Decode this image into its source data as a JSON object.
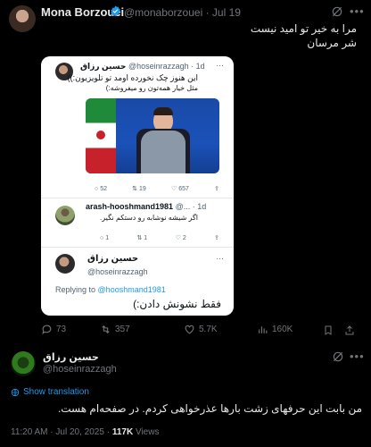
{
  "main_post": {
    "display_name": "Mona Borzouei",
    "handle": "@monaborzouei",
    "dot": "·",
    "date": "Jul 19",
    "text_line1": "مرا به خیر تو امید نیست",
    "text_line2": "شر مرسان"
  },
  "screenshot": {
    "tweet1": {
      "name": "حسین رزاق",
      "handle": "@hoseinrazzagh",
      "time": "· 1d",
      "line1": "این هنوز چک نخورده اومد تو تلویزیون:))",
      "line2": "مثل خیار همه‌تون رو میفروشه:)",
      "stats": {
        "replies": "52",
        "reposts": "19",
        "likes": "657"
      }
    },
    "tweet2": {
      "name": "arash-hooshmand1981",
      "handle": "@...",
      "time": "· 1d",
      "text": "اگر شیشه نوشابه رو دستکم نگیر.",
      "stats": {
        "replies": "1",
        "reposts": "1",
        "likes": "2"
      }
    },
    "tweet3": {
      "name": "حسین رزاق",
      "handle": "@hoseinrazzagh",
      "replying_prefix": "Replying to",
      "replying_to": "@hooshmand1981",
      "text": "فقط نشونش دادن:)"
    }
  },
  "main_actions": {
    "replies": "73",
    "reposts": "357",
    "likes": "5.7K",
    "views": "160K"
  },
  "reply": {
    "display_name": "حسین رزاق",
    "handle": "@hoseinrazzagh",
    "show_translation": "Show translation",
    "text": "من بابت این حرفهای زشت بارها عذرخواهی کردم. در صفحه‌ام هست.",
    "time": "11:20 AM",
    "date": "Jul 20, 2025",
    "views_count": "117K",
    "views_label": "Views"
  },
  "colors": {
    "background": "#000000",
    "accent": "#1d9bf0",
    "muted": "#71767b",
    "verified": "#1d9bf0"
  }
}
